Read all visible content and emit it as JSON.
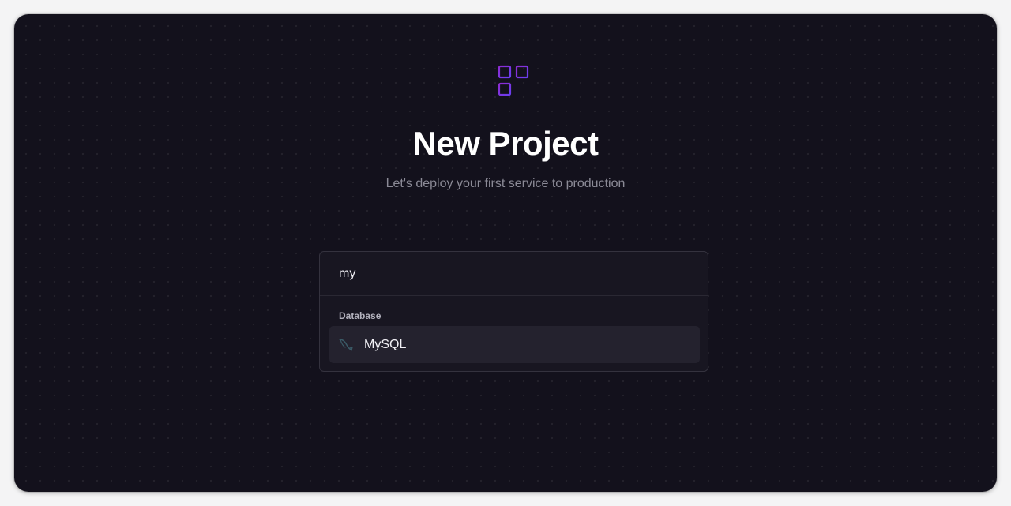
{
  "page": {
    "title": "New Project",
    "subtitle": "Let's deploy your first service to production"
  },
  "search": {
    "value": "my"
  },
  "results": {
    "group_label": "Database",
    "items": [
      {
        "label": "MySQL",
        "icon": "mysql-dolphin-icon"
      }
    ]
  },
  "colors": {
    "accent": "#8b3dd9",
    "background": "#13111c",
    "text_primary": "#ffffff",
    "text_muted": "#8b8a96"
  }
}
